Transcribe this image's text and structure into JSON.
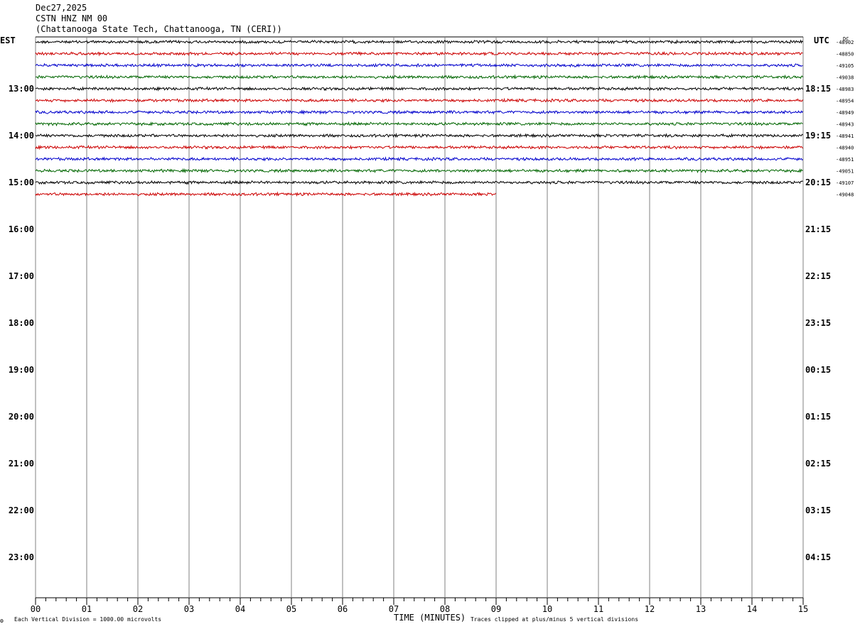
{
  "header": {
    "date": "Dec27,2025",
    "station": "CSTN HNZ NM 00",
    "location": "(Chattanooga State Tech, Chattanooga, TN (CERI))"
  },
  "left_axis_label": "EST",
  "right_axis_label": "UTC",
  "dc_label": "DC",
  "footer": {
    "scale_note": "Each Vertical Division = 1000.00 microvolts",
    "xlabel": "TIME (MINUTES)",
    "clip_note": "Traces clipped at plus/minus 5 vertical divisions",
    "corner_mark": "⚙"
  },
  "colors": {
    "background": "#ffffff",
    "grid": "#808080",
    "trace_cycle": [
      "#000000",
      "#cc0000",
      "#0000cc",
      "#006600"
    ]
  },
  "chart_data": {
    "type": "line",
    "title": "CSTN HNZ NM 00",
    "xlabel": "TIME (MINUTES)",
    "xlim": [
      0,
      15
    ],
    "x_ticks": [
      "00",
      "01",
      "02",
      "03",
      "04",
      "05",
      "06",
      "07",
      "08",
      "09",
      "10",
      "11",
      "12",
      "13",
      "14",
      "15"
    ],
    "left_hour_labels": [
      "13:00",
      "14:00",
      "15:00",
      "16:00",
      "17:00",
      "18:00",
      "19:00",
      "20:00",
      "21:00",
      "22:00",
      "23:00"
    ],
    "right_hour_labels": [
      "18:15",
      "19:15",
      "20:15",
      "21:15",
      "22:15",
      "23:15",
      "00:15",
      "01:15",
      "02:15",
      "03:15",
      "04:15"
    ],
    "first_labeled_trace_index": 4,
    "traces_per_hour": 4,
    "total_trace_slots": 48,
    "series": [
      {
        "dc": "-48902",
        "color": "#000000",
        "end_minute": 15
      },
      {
        "dc": "-48850",
        "color": "#cc0000",
        "end_minute": 15
      },
      {
        "dc": "-49105",
        "color": "#0000cc",
        "end_minute": 15
      },
      {
        "dc": "-49038",
        "color": "#006600",
        "end_minute": 15
      },
      {
        "dc": "-48983",
        "color": "#000000",
        "end_minute": 15
      },
      {
        "dc": "-48954",
        "color": "#cc0000",
        "end_minute": 15
      },
      {
        "dc": "-48949",
        "color": "#0000cc",
        "end_minute": 15
      },
      {
        "dc": "-48943",
        "color": "#006600",
        "end_minute": 15
      },
      {
        "dc": "-48941",
        "color": "#000000",
        "end_minute": 15
      },
      {
        "dc": "-48940",
        "color": "#cc0000",
        "end_minute": 15
      },
      {
        "dc": "-48951",
        "color": "#0000cc",
        "end_minute": 15
      },
      {
        "dc": "-49051",
        "color": "#006600",
        "end_minute": 15
      },
      {
        "dc": "-49107",
        "color": "#000000",
        "end_minute": 15
      },
      {
        "dc": "-49048",
        "color": "#cc0000",
        "end_minute": 9
      }
    ]
  }
}
